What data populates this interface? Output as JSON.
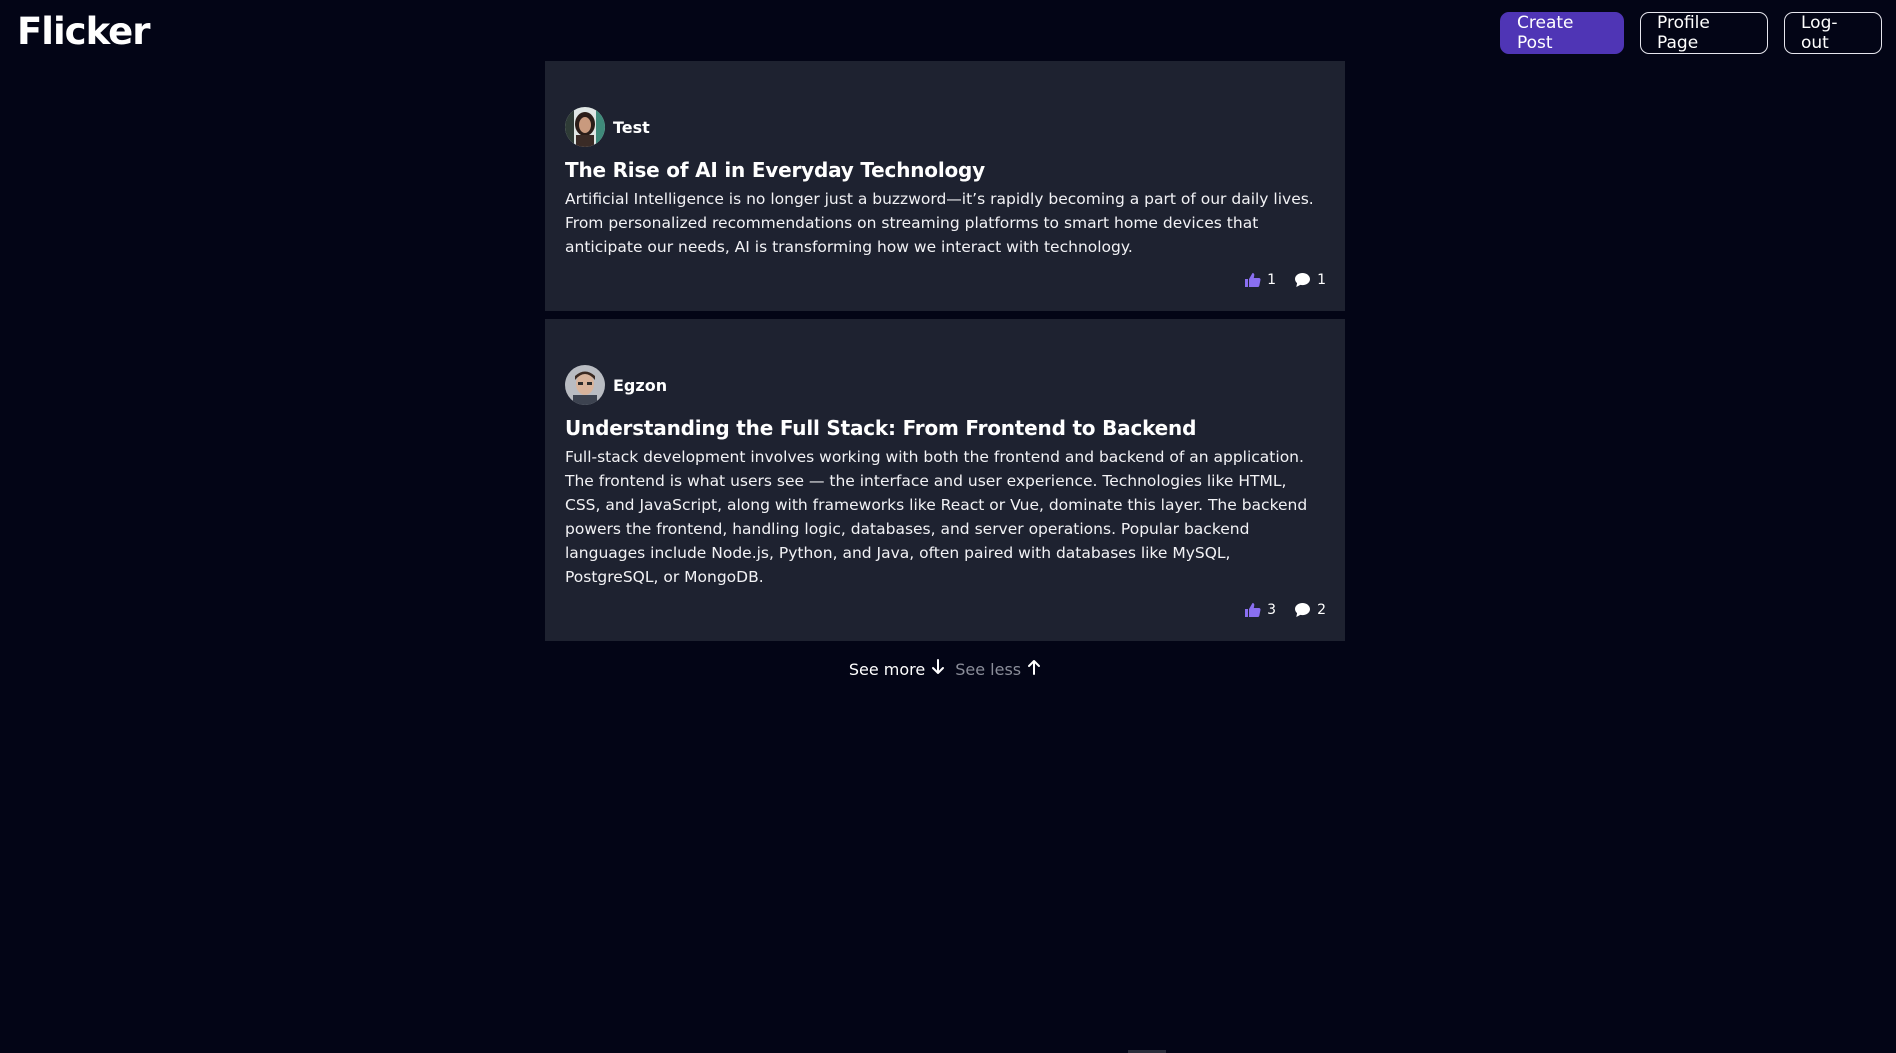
{
  "app": {
    "logo": "Flicker"
  },
  "header": {
    "create_post_label": "Create Post",
    "profile_label": "Profile Page",
    "logout_label": "Log-out"
  },
  "posts": [
    {
      "author": "Test",
      "title": "The Rise of AI in Everyday Technology",
      "body": "Artificial Intelligence is no longer just a buzzword—it’s rapidly becoming a part of our daily lives. From personalized recommendations on streaming platforms to smart home devices that anticipate our needs, AI is transforming how we interact with technology.",
      "likes": "1",
      "comments": "1"
    },
    {
      "author": "Egzon",
      "title": "Understanding the Full Stack: From Frontend to Backend",
      "body": "Full-stack development involves working with both the frontend and backend of an application. The frontend is what users see — the interface and user experience. Technologies like HTML, CSS, and JavaScript, along with frameworks like React or Vue, dominate this layer. The backend powers the frontend, handling logic, databases, and server operations. Popular backend languages include Node.js, Python, and Java, often paired with databases like MySQL, PostgreSQL, or MongoDB.",
      "likes": "3",
      "comments": "2"
    }
  ],
  "pager": {
    "see_more": "See more",
    "see_less": "See less"
  },
  "colors": {
    "background": "#030516",
    "card": "#1e2230",
    "accent": "#4f35b5",
    "like_icon": "#8a6ff0",
    "muted_text": "#8a8d99"
  },
  "icons": {
    "like": "thumbs-up-icon",
    "comment": "comment-icon",
    "see_more": "arrow-down-icon",
    "see_less": "arrow-up-icon"
  }
}
